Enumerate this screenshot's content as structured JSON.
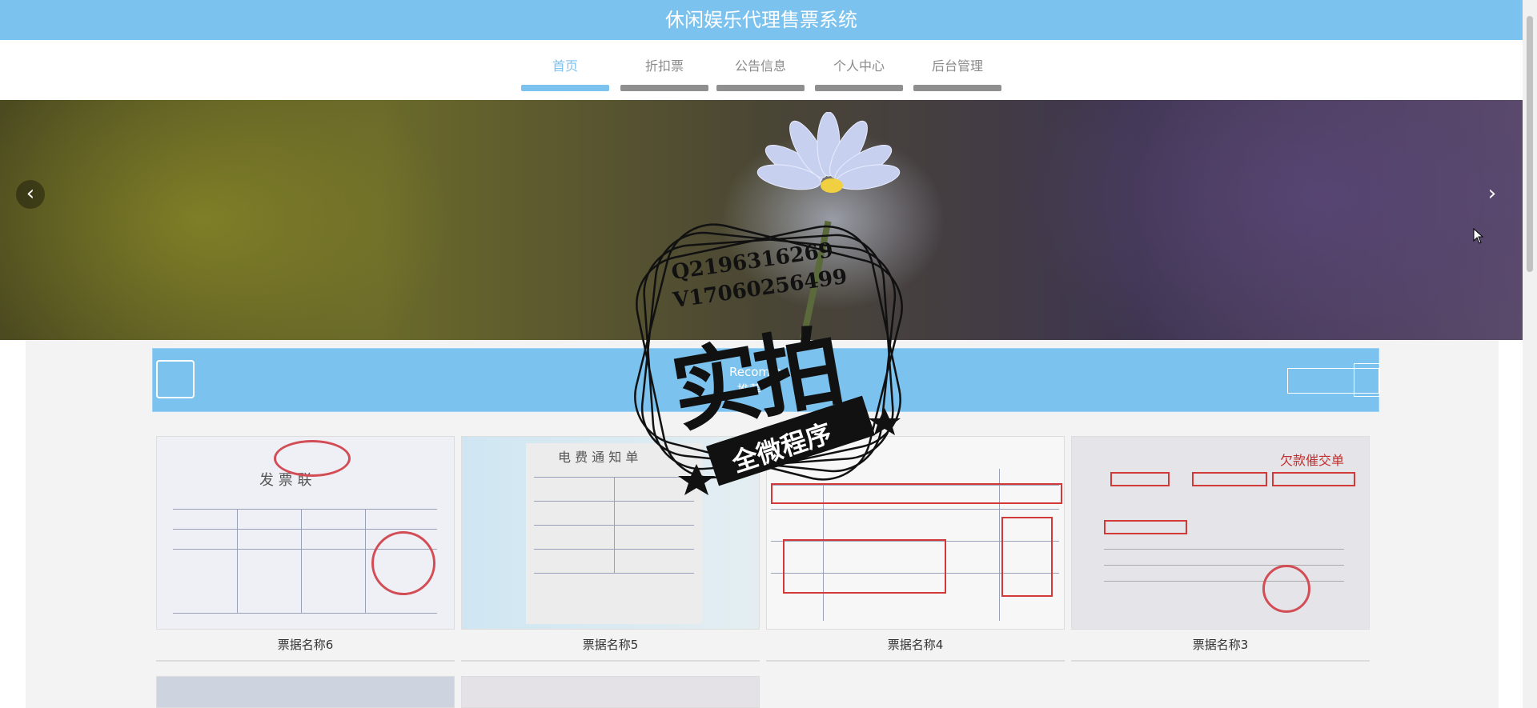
{
  "header": {
    "title": "休闲娱乐代理售票系统"
  },
  "nav": {
    "items": [
      {
        "label": "首页",
        "active": true
      },
      {
        "label": "折扣票",
        "active": false
      },
      {
        "label": "公告信息",
        "active": false
      },
      {
        "label": "个人中心",
        "active": false
      },
      {
        "label": "后台管理",
        "active": false
      }
    ]
  },
  "banner": {
    "prev_icon": "chevron-left-icon",
    "next_icon": "chevron-right-icon",
    "prev_glyph": "‹",
    "next_glyph": "›"
  },
  "section": {
    "title_en": "Recomm",
    "title_zh": "推荐"
  },
  "cards": [
    {
      "name": "票据名称6",
      "doc_text": "发 票 联"
    },
    {
      "name": "票据名称5",
      "doc_text": "电 费 通 知 单"
    },
    {
      "name": "票据名称4",
      "doc_text": ""
    },
    {
      "name": "票据名称3",
      "doc_text": "欠款催交单"
    }
  ],
  "watermark": {
    "line1": "Q2196316269",
    "line2": "V17060256499",
    "big": "实拍",
    "band": "全微程序"
  },
  "colors": {
    "accent": "#7cc2ee",
    "nav_inactive": "#8f8f8f"
  }
}
